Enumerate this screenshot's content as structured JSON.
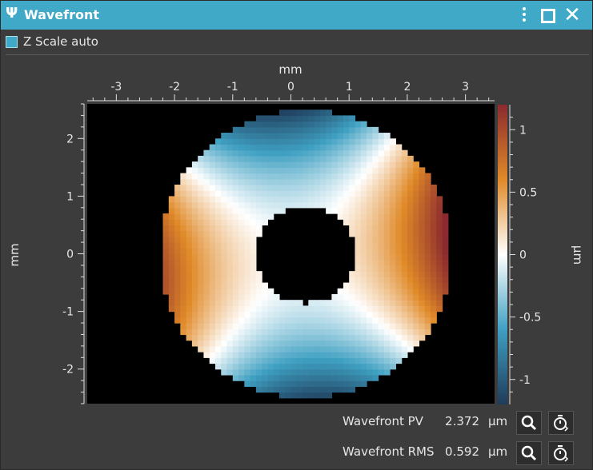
{
  "window": {
    "title": "Wavefront",
    "title_icon": "psi-icon"
  },
  "toolbar": {
    "z_scale_auto_label": "Z Scale auto",
    "z_scale_auto_checked": true
  },
  "plot": {
    "x_axis_label": "mm",
    "y_axis_label": "mm",
    "colorbar_label": "µm",
    "x_ticks": [
      "-3",
      "-2",
      "-1",
      "0",
      "1",
      "2",
      "3"
    ],
    "y_ticks": [
      "2",
      "1",
      "0",
      "-1",
      "-2"
    ],
    "colorbar_ticks": [
      "1",
      "0.5",
      "0",
      "-0.5",
      "-1"
    ],
    "colormap": [
      "#1f3b5a",
      "#3fa0c2",
      "#ffffff",
      "#e08a28",
      "#8b2a2e"
    ],
    "background": "#000000"
  },
  "chart_data": {
    "type": "heatmap",
    "x_range_mm": [
      -3.5,
      3.5
    ],
    "y_range_mm": [
      -2.6,
      2.6
    ],
    "z_range_um": [
      -1.2,
      1.2
    ],
    "outer_radius_mm": 2.5,
    "inner_radius_mm": 0.85,
    "center_mm": [
      0.25,
      0.0
    ],
    "legend": "right colorbar"
  },
  "readouts": [
    {
      "label": "Wavefront PV",
      "value": "2.372",
      "unit": "µm"
    },
    {
      "label": "Wavefront RMS",
      "value": "0.592",
      "unit": "µm"
    }
  ]
}
